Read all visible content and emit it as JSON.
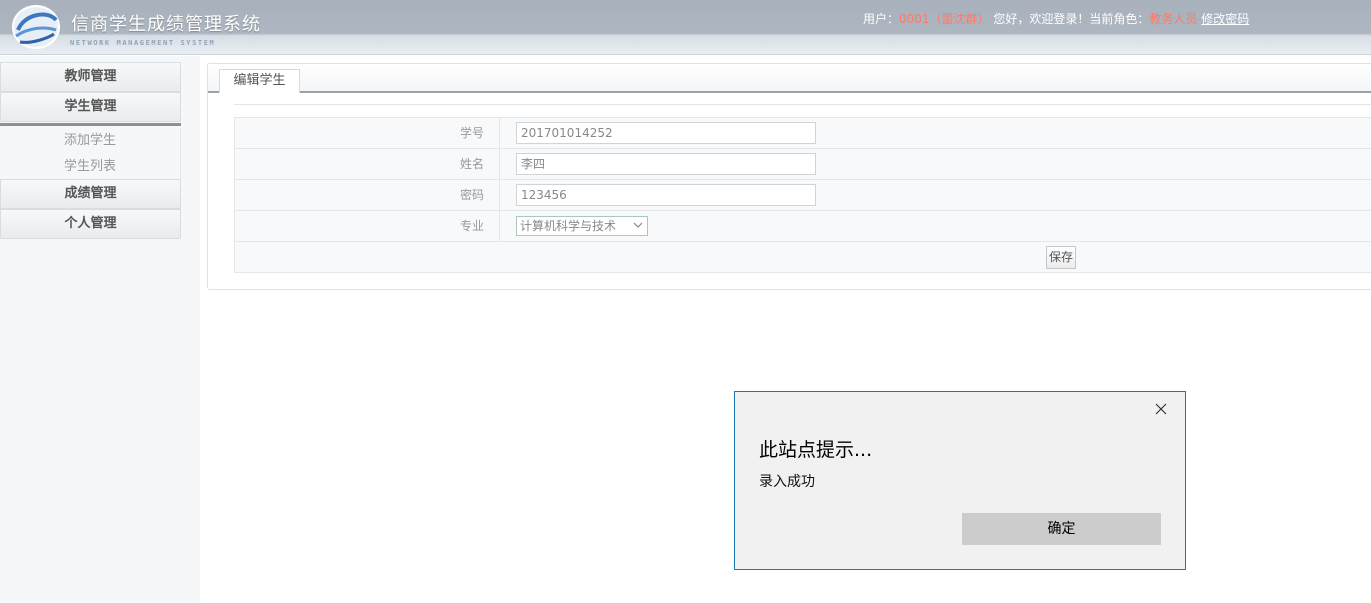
{
  "header": {
    "title": "信商学生成绩管理系统",
    "subtitle": "NETWORK MANAGEMENT SYSTEM",
    "user_prefix": "用户：",
    "user_id": "0001（蕾沈群）",
    "welcome": "您好，欢迎登录！当前角色：",
    "role": "教务人员",
    "change_password": "修改密码",
    "logo_icon": "logo-swirl-icon"
  },
  "sidebar": {
    "menus": [
      {
        "label": "教师管理"
      },
      {
        "label": "学生管理"
      },
      {
        "label": "成绩管理"
      },
      {
        "label": "个人管理"
      }
    ],
    "submenu": [
      {
        "label": "添加学生"
      },
      {
        "label": "学生列表"
      }
    ]
  },
  "main": {
    "tab": "编辑学生",
    "form": {
      "student_id_label": "学号",
      "student_id_value": "201701014252",
      "name_label": "姓名",
      "name_value": "李四",
      "password_label": "密码",
      "password_value": "123456",
      "major_label": "专业",
      "major_value": "计算机科学与技术",
      "save_label": "保存"
    }
  },
  "dialog": {
    "title": "此站点提示...",
    "message": "录入成功",
    "ok_label": "确定",
    "close_icon": "close-icon"
  }
}
